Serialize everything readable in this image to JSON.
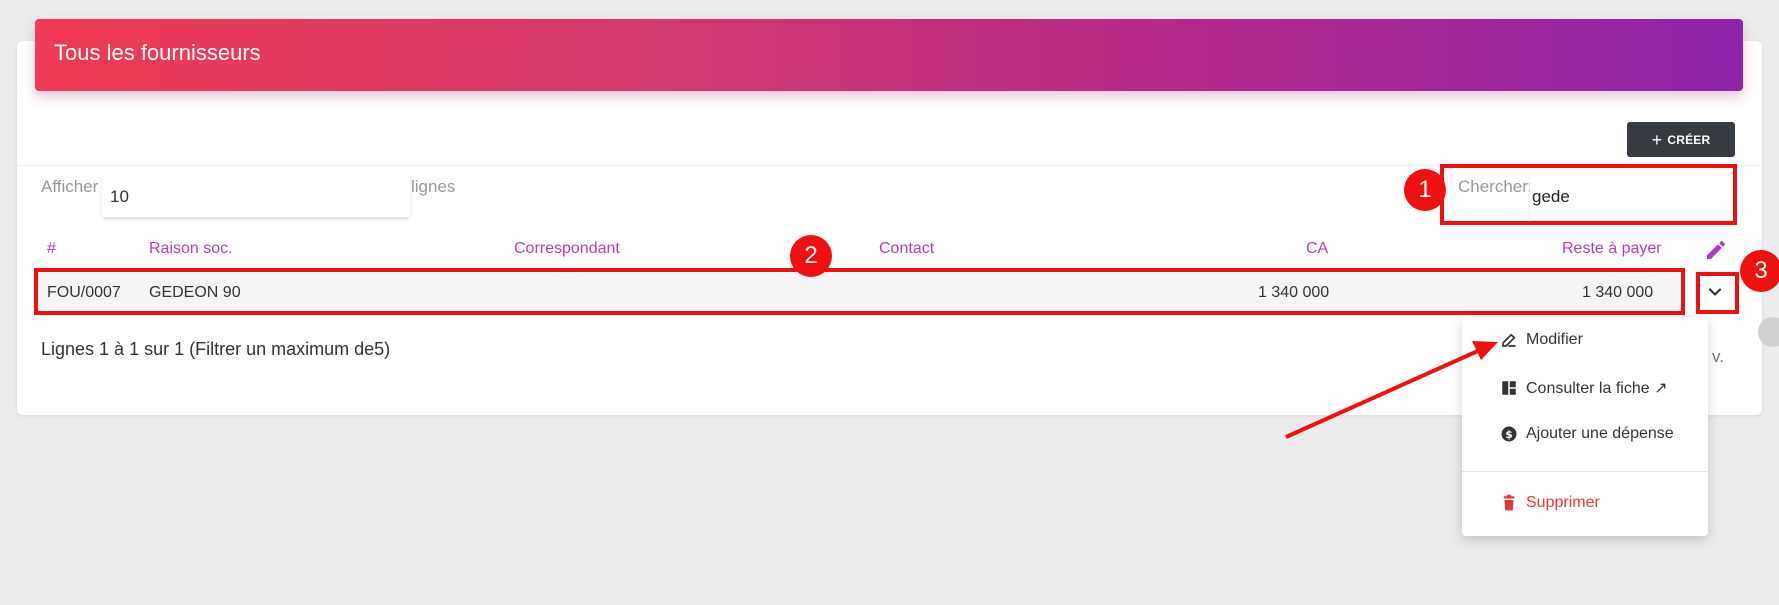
{
  "header": {
    "title": "Tous les fournisseurs"
  },
  "toolbar": {
    "create_label": "CRÉER",
    "create_plus": "+"
  },
  "length_control": {
    "prefix": "Afficher",
    "value": "10",
    "suffix": "lignes"
  },
  "search": {
    "label": "Chercher:",
    "value": "gede"
  },
  "table": {
    "columns": [
      "#",
      "Raison soc.",
      "Correspondant",
      "Contact",
      "CA",
      "Reste à payer"
    ],
    "rows": [
      {
        "id": "FOU/0007",
        "raison": "GEDEON 90",
        "correspondant": "",
        "contact": "",
        "ca": "1 340 000",
        "reste": "1 340 000"
      }
    ]
  },
  "info": "Lignes 1 à 1 sur 1 (Filtrer un maximum de5)",
  "pagination": {
    "prev_fragment": "v."
  },
  "dropdown": {
    "items": [
      {
        "label": "Modifier",
        "icon": "pencil-icon"
      },
      {
        "label": "Consulter la fiche ↗",
        "icon": "layout-icon"
      },
      {
        "label": "Ajouter une dépense",
        "icon": "dollar-circle-icon"
      },
      {
        "label": "Supprimer",
        "icon": "trash-icon",
        "color": "#e53935"
      }
    ]
  },
  "annotations": {
    "badge1": "1",
    "badge2": "2",
    "badge3": "3",
    "color": "#f01010"
  },
  "colors": {
    "accent": "#b53fb0",
    "gradient_start": "#ef3b53",
    "gradient_end": "#8e24aa",
    "button": "#363b42"
  }
}
